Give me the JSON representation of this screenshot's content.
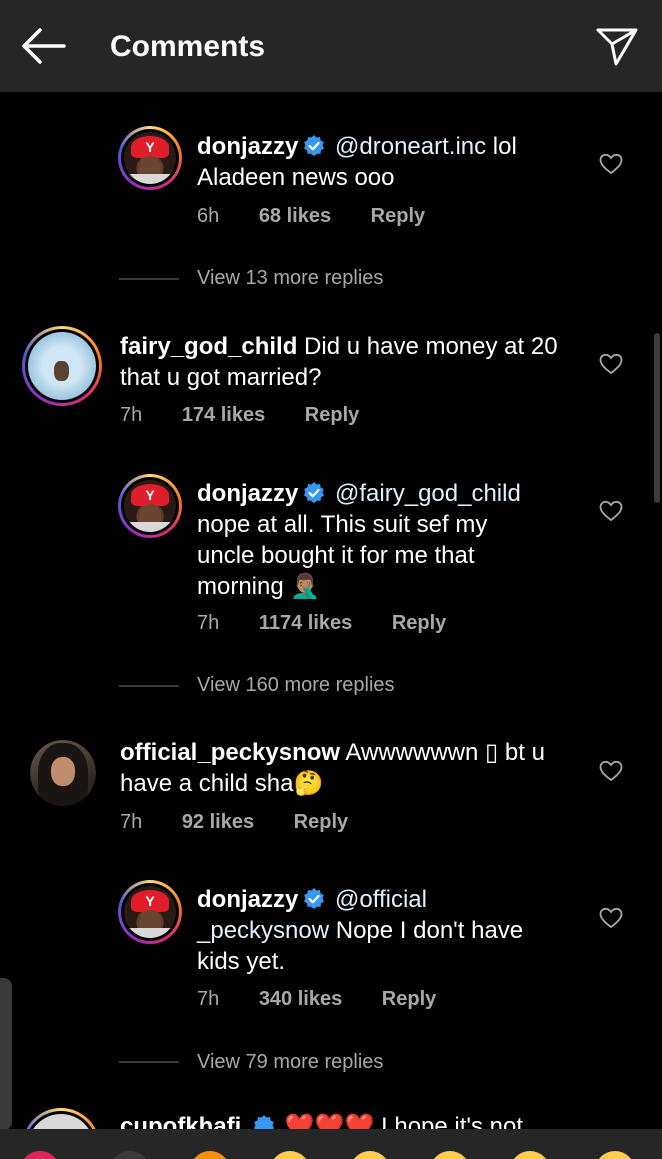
{
  "header": {
    "title": "Comments",
    "back_icon": "arrow-left-icon",
    "send_icon": "paper-plane-icon"
  },
  "comments": [
    {
      "username": "donjazzy",
      "verified": true,
      "mention": "@droneart.inc",
      "text_lines": [
        "lol",
        "Aladeen news ooo"
      ],
      "time": "6h",
      "likes": "68 likes",
      "reply": "Reply"
    },
    {
      "username": "fairy_god_child",
      "verified": false,
      "text_lines": [
        "Did u have money at 20",
        "that u got married?"
      ],
      "time": "7h",
      "likes": "174 likes",
      "reply": "Reply"
    },
    {
      "username": "donjazzy",
      "verified": true,
      "mention": "@fairy_god_child",
      "text_lines": [
        "nope at all. This suit sef my",
        "uncle bought it for me that",
        "morning 🤦🏽‍♂️"
      ],
      "time": "7h",
      "likes": "1174 likes",
      "reply": "Reply"
    },
    {
      "username": "official_peckysnow",
      "verified": false,
      "text_lines": [
        "Awwwwwwn ▯ bt u",
        "have a child sha🤔"
      ],
      "time": "7h",
      "likes": "92 likes",
      "reply": "Reply"
    },
    {
      "username": "donjazzy",
      "verified": true,
      "mention": "@official",
      "mention_cont": "_peckysnow",
      "text_lines": [
        "Nope I don't have",
        "kids yet."
      ],
      "time": "7h",
      "likes": "340 likes",
      "reply": "Reply"
    }
  ],
  "view_replies": [
    "View 13 more replies",
    "View 160 more replies",
    "View 79 more replies"
  ],
  "partial_comment": {
    "username": "cupofkhafi",
    "text": "❤️❤️❤️ I hope it's not"
  },
  "colors": {
    "background": "#000000",
    "header": "#262626",
    "secondary_text": "#a8a8a8",
    "verified": "#3897f0"
  }
}
